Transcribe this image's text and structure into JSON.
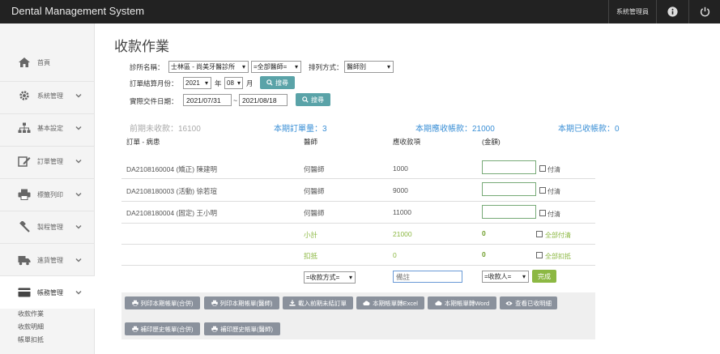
{
  "app": {
    "title": "Dental Management System",
    "user": "系統管理員"
  },
  "sidebar": {
    "items": [
      {
        "label": "首頁",
        "icon": "home-icon"
      },
      {
        "label": "系統管理",
        "icon": "gear-icon"
      },
      {
        "label": "基本設定",
        "icon": "sitemap-icon"
      },
      {
        "label": "訂單管理",
        "icon": "edit-icon"
      },
      {
        "label": "標籤列印",
        "icon": "printer-icon"
      },
      {
        "label": "製程管理",
        "icon": "gavel-icon"
      },
      {
        "label": "進貨管理",
        "icon": "truck-icon"
      },
      {
        "label": "帳務管理",
        "icon": "card-icon"
      }
    ],
    "subitems": [
      "收款作業",
      "收款明細",
      "帳單扣抵"
    ]
  },
  "page": {
    "title": "收款作業"
  },
  "filters": {
    "clinic_label": "診所名稱：",
    "clinic_value": "士林區 - 尚美牙醫診所",
    "doctor_value": "=全部醫師=",
    "sort_label": "排列方式：",
    "sort_value": "醫師別",
    "month_label": "訂單結算月份：",
    "year": "2021",
    "year_unit": "年",
    "month": "08",
    "month_unit": "月",
    "search_label": "搜尋",
    "date_label": "實際交件日期：",
    "date_from": "2021/07/31",
    "date_sep": "~",
    "date_to": "2021/08/18"
  },
  "summary": {
    "prev_unpaid": "前期未收款：16100",
    "orders": "本期訂單量：3",
    "receivable": "本期應收帳款：21000",
    "received": "本期已收帳款：0"
  },
  "table": {
    "headers": [
      "訂單 - 病患",
      "醫師",
      "應收款項",
      "(金額)"
    ],
    "rows": [
      {
        "order": "DA2108160004 (矯正) 陳建明",
        "doctor": "何醫師",
        "amount": "1000"
      },
      {
        "order": "DA2108180003 (活動) 徐若瑄",
        "doctor": "何醫師",
        "amount": "9000"
      },
      {
        "order": "DA2108180004 (固定) 王小明",
        "doctor": "何醫師",
        "amount": "11000"
      }
    ],
    "paid_label": "付清",
    "subtotal_label": "小計",
    "subtotal_amount": "21000",
    "subtotal_paid": "0",
    "all_paid_label": "全部付清",
    "deduct_label": "扣抵",
    "deduct_amount": "0",
    "deduct_paid": "0",
    "all_deduct_label": "全部扣抵",
    "pay_method": "=收款方式=",
    "note_placeholder": "備註",
    "payee": "=收款人=",
    "done_label": "完成"
  },
  "actions": {
    "row1": [
      {
        "label": "列印本期帳單(合併)",
        "icon": "printer-icon"
      },
      {
        "label": "列印本期帳單(醫師)",
        "icon": "printer-icon"
      },
      {
        "label": "載入前期未結訂單",
        "icon": "download-icon"
      },
      {
        "label": "本期帳單轉Excel",
        "icon": "cloud-icon"
      },
      {
        "label": "本期帳單轉Word",
        "icon": "cloud-icon"
      },
      {
        "label": "查看已收明細",
        "icon": "eye-icon"
      }
    ],
    "row2": [
      {
        "label": "補印歷史帳單(合併)",
        "icon": "printer-icon"
      },
      {
        "label": "補印歷史帳單(醫師)",
        "icon": "printer-icon"
      }
    ]
  },
  "colors": {
    "accent": "#3a8fd6",
    "green": "#8cb843",
    "search": "#5aa3a8",
    "gray_button": "#8a919c"
  }
}
